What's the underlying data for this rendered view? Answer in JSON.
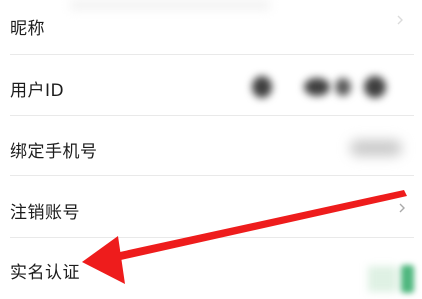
{
  "settings": {
    "items": [
      {
        "label": "昵称"
      },
      {
        "label": "用户ID"
      },
      {
        "label": "绑定手机号"
      },
      {
        "label": "注销账号"
      },
      {
        "label": "实名认证"
      }
    ]
  },
  "colors": {
    "annotation_arrow": "#ee1c1c",
    "text": "#1c1c1c",
    "divider": "#e9e9e9",
    "status_green": "#4fb77e"
  }
}
